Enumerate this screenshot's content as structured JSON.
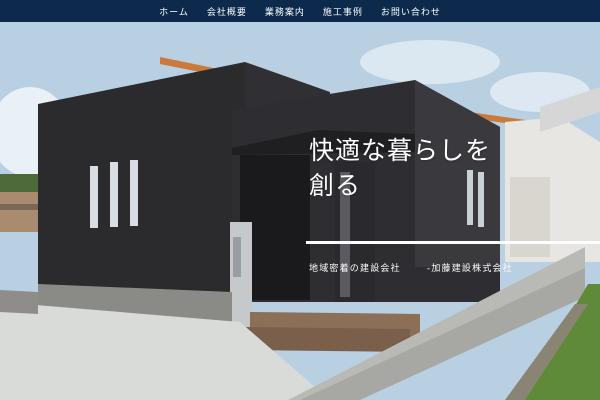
{
  "nav": {
    "items": [
      {
        "label": "ホーム"
      },
      {
        "label": "会社概要"
      },
      {
        "label": "業務案内"
      },
      {
        "label": "施工事例"
      },
      {
        "label": "お問い合わせ"
      }
    ]
  },
  "hero": {
    "headline_line1": "快適な暮らしを",
    "headline_line2": "創る",
    "sub_left": "地域密着の建設会社",
    "sub_right": "-加藤建設株式会社"
  },
  "colors": {
    "nav_bg": "#0d2a4c",
    "text": "#ffffff",
    "house_wall": "#2a2a2c"
  }
}
